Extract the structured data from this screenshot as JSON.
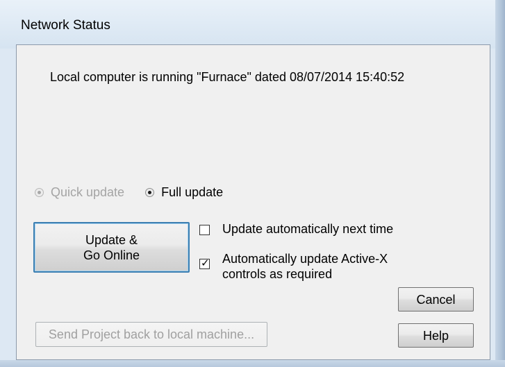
{
  "window": {
    "title": "Network Status"
  },
  "status": {
    "message": "Local computer is running \"Furnace\" dated 08/07/2014 15:40:52"
  },
  "update_mode": {
    "options": [
      {
        "label": "Quick update",
        "selected": false,
        "enabled": false
      },
      {
        "label": "Full update",
        "selected": true,
        "enabled": true
      }
    ]
  },
  "buttons": {
    "update_go_online_line1": "Update &",
    "update_go_online_line2": "Go Online",
    "cancel": "Cancel",
    "help": "Help",
    "send_project": "Send Project back to local machine..."
  },
  "options": {
    "auto_next_time": {
      "label": "Update automatically next time",
      "checked": false
    },
    "auto_activex_line1": "Automatically update Active-X",
    "auto_activex_line2": "controls as required",
    "auto_activex_checked": true
  },
  "icons": {
    "checkmark": "check-icon"
  },
  "colors": {
    "default_button_border": "#3c7fb1",
    "window_frame": "#dde8f3",
    "client_background": "#f0f0f0"
  }
}
